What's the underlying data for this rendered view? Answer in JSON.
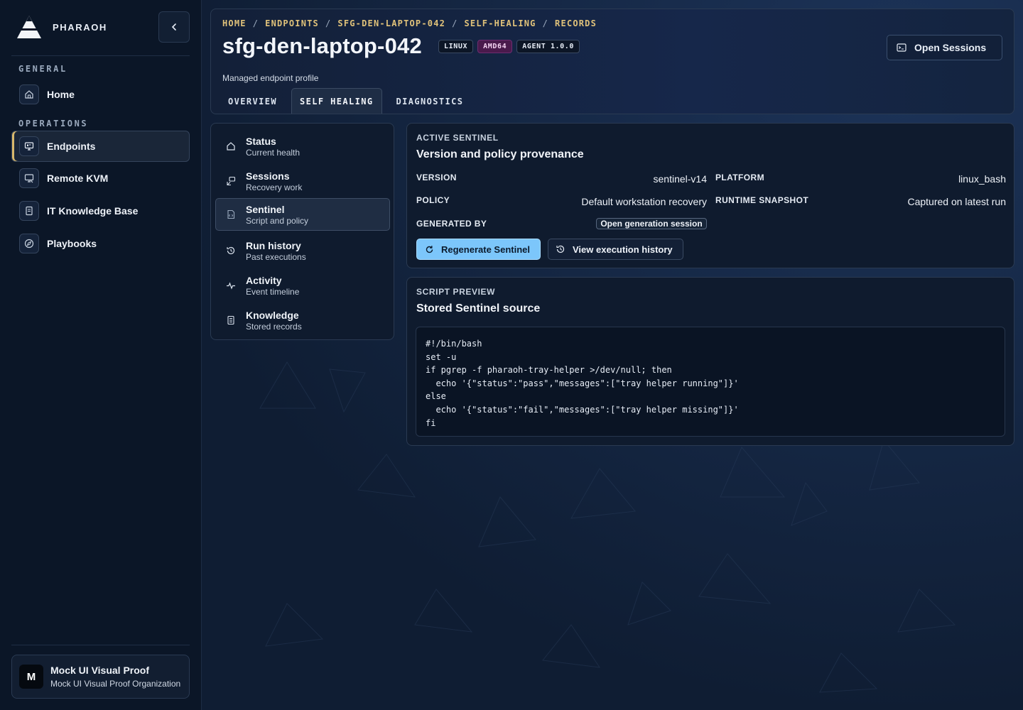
{
  "app": {
    "brand": "PHARAOH"
  },
  "sidebar": {
    "sections": [
      {
        "label": "GENERAL"
      },
      {
        "label": "OPERATIONS"
      }
    ],
    "items": [
      {
        "label": "Home",
        "icon": "home-icon"
      },
      {
        "label": "Endpoints",
        "icon": "monitor-icon"
      },
      {
        "label": "Remote KVM",
        "icon": "remote-screen-icon"
      },
      {
        "label": "IT Knowledge Base",
        "icon": "book-icon"
      },
      {
        "label": "Playbooks",
        "icon": "compass-icon"
      }
    ],
    "active_item": "Endpoints",
    "org": {
      "avatar_letter": "M",
      "name": "Mock UI Visual Proof",
      "subtitle": "Mock UI Visual Proof Organization"
    }
  },
  "header": {
    "breadcrumb": [
      "HOME",
      "ENDPOINTS",
      "SFG-DEN-LAPTOP-042",
      "SELF-HEALING",
      "RECORDS"
    ],
    "title": "sfg-den-laptop-042",
    "badges": [
      "LINUX",
      "AMD64",
      "AGENT 1.0.0"
    ],
    "subtitle": "Managed endpoint profile",
    "open_sessions_label": "Open Sessions",
    "tabs": [
      "OVERVIEW",
      "SELF HEALING",
      "DIAGNOSTICS"
    ],
    "active_tab": "SELF HEALING"
  },
  "subnav": {
    "items": [
      {
        "title": "Status",
        "desc": "Current health",
        "icon": "home-icon"
      },
      {
        "title": "Sessions",
        "desc": "Recovery work",
        "icon": "session-icon"
      },
      {
        "title": "Sentinel",
        "desc": "Script and policy",
        "icon": "file-script-icon"
      },
      {
        "title": "Run history",
        "desc": "Past executions",
        "icon": "history-icon"
      },
      {
        "title": "Activity",
        "desc": "Event timeline",
        "icon": "pulse-icon"
      },
      {
        "title": "Knowledge",
        "desc": "Stored records",
        "icon": "document-icon"
      }
    ],
    "active_item": "Sentinel"
  },
  "sentinel": {
    "kicker": "ACTIVE SENTINEL",
    "title": "Version and policy provenance",
    "fields": {
      "version_label": "VERSION",
      "version_value": "sentinel-v14",
      "platform_label": "PLATFORM",
      "platform_value": "linux_bash",
      "policy_label": "POLICY",
      "policy_value": "Default workstation recovery",
      "snapshot_label": "RUNTIME SNAPSHOT",
      "snapshot_value": "Captured on latest run",
      "generated_label": "GENERATED BY",
      "generated_link": "Open generation session"
    },
    "regenerate_label": "Regenerate Sentinel",
    "history_label": "View execution history"
  },
  "script": {
    "kicker": "SCRIPT PREVIEW",
    "title": "Stored Sentinel source",
    "lines": [
      "#!/bin/bash",
      "set -u",
      "if pgrep -f pharaoh-tray-helper >/dev/null; then",
      "  echo '{\"status\":\"pass\",\"messages\":[\"tray helper running\"]}'",
      "else",
      "  echo '{\"status\":\"fail\",\"messages\":[\"tray helper missing\"]}'",
      "fi"
    ]
  },
  "colors": {
    "accent": "#7cc6fb",
    "breadcrumb": "#e0c27a",
    "sidebar_active_marker": "#d9b86b",
    "arch_badge": "#4a1a4c"
  }
}
